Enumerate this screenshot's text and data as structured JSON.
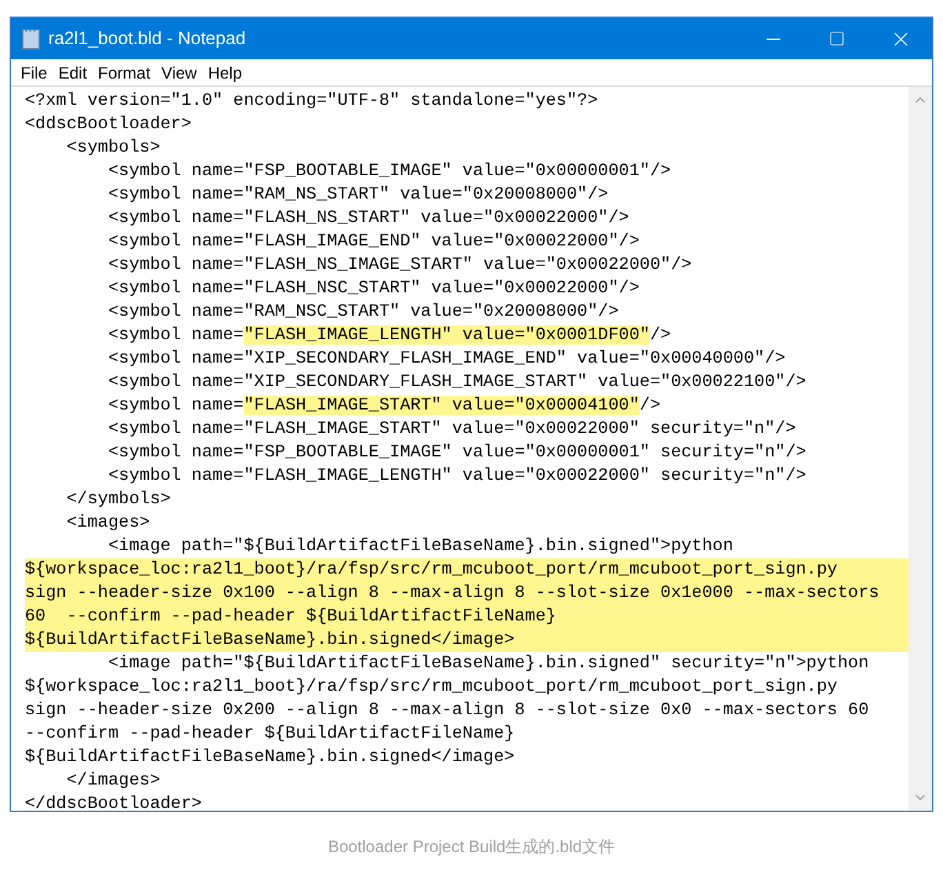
{
  "window": {
    "title": "ra2l1_boot.bld - Notepad"
  },
  "menu": [
    "File",
    "Edit",
    "Format",
    "View",
    "Help"
  ],
  "editor": {
    "lines": [
      {
        "kind": "plain",
        "text": "<?xml version=\"1.0\" encoding=\"UTF-8\" standalone=\"yes\"?>",
        "highlighted": false
      },
      {
        "kind": "plain",
        "text": "<ddscBootloader>",
        "highlighted": false
      },
      {
        "kind": "plain",
        "text": "    <symbols>",
        "highlighted": false
      },
      {
        "kind": "plain",
        "text": "        <symbol name=\"FSP_BOOTABLE_IMAGE\" value=\"0x00000001\"/>",
        "highlighted": false
      },
      {
        "kind": "plain",
        "text": "        <symbol name=\"RAM_NS_START\" value=\"0x20008000\"/>",
        "highlighted": false
      },
      {
        "kind": "plain",
        "text": "        <symbol name=\"FLASH_NS_START\" value=\"0x00022000\"/>",
        "highlighted": false
      },
      {
        "kind": "plain",
        "text": "        <symbol name=\"FLASH_IMAGE_END\" value=\"0x00022000\"/>",
        "highlighted": false
      },
      {
        "kind": "plain",
        "text": "        <symbol name=\"FLASH_NS_IMAGE_START\" value=\"0x00022000\"/>",
        "highlighted": false
      },
      {
        "kind": "plain",
        "text": "        <symbol name=\"FLASH_NSC_START\" value=\"0x00022000\"/>",
        "highlighted": false
      },
      {
        "kind": "plain",
        "text": "        <symbol name=\"RAM_NSC_START\" value=\"0x20008000\"/>",
        "highlighted": false
      },
      {
        "kind": "mixed",
        "segments": [
          {
            "text": "        <symbol name=",
            "highlighted": false
          },
          {
            "text": "\"FLASH_IMAGE_LENGTH\" value=\"0x0001DF00\"",
            "highlighted": true
          },
          {
            "text": "/>",
            "highlighted": false
          }
        ]
      },
      {
        "kind": "plain",
        "text": "        <symbol name=\"XIP_SECONDARY_FLASH_IMAGE_END\" value=\"0x00040000\"/>",
        "highlighted": false
      },
      {
        "kind": "plain",
        "text": "        <symbol name=\"XIP_SECONDARY_FLASH_IMAGE_START\" value=\"0x00022100\"/>",
        "highlighted": false
      },
      {
        "kind": "mixed",
        "segments": [
          {
            "text": "        <symbol name=",
            "highlighted": false
          },
          {
            "text": "\"FLASH_IMAGE_START\" value=\"0x00004100\"",
            "highlighted": true
          },
          {
            "text": "/>",
            "highlighted": false
          }
        ]
      },
      {
        "kind": "plain",
        "text": "        <symbol name=\"FLASH_IMAGE_START\" value=\"0x00022000\" security=\"n\"/>",
        "highlighted": false
      },
      {
        "kind": "plain",
        "text": "        <symbol name=\"FSP_BOOTABLE_IMAGE\" value=\"0x00000001\" security=\"n\"/>",
        "highlighted": false
      },
      {
        "kind": "plain",
        "text": "        <symbol name=\"FLASH_IMAGE_LENGTH\" value=\"0x00022000\" security=\"n\"/>",
        "highlighted": false
      },
      {
        "kind": "plain",
        "text": "    </symbols>",
        "highlighted": false
      },
      {
        "kind": "plain",
        "text": "    <images>",
        "highlighted": false
      },
      {
        "kind": "plain",
        "text": "        <image path=\"${BuildArtifactFileBaseName}.bin.signed\">python",
        "highlighted": false
      },
      {
        "kind": "plain",
        "text": "${workspace_loc:ra2l1_boot}/ra/fsp/src/rm_mcuboot_port/rm_mcuboot_port_sign.py",
        "highlighted": true
      },
      {
        "kind": "plain",
        "text": "sign --header-size 0x100 --align 8 --max-align 8 --slot-size 0x1e000 --max-sectors",
        "highlighted": true
      },
      {
        "kind": "plain",
        "text": "60  --confirm --pad-header ${BuildArtifactFileName}",
        "highlighted": true
      },
      {
        "kind": "plain",
        "text": "${BuildArtifactFileBaseName}.bin.signed</image>",
        "highlighted": true
      },
      {
        "kind": "plain",
        "text": "        <image path=\"${BuildArtifactFileBaseName}.bin.signed\" security=\"n\">python",
        "highlighted": false
      },
      {
        "kind": "plain",
        "text": "${workspace_loc:ra2l1_boot}/ra/fsp/src/rm_mcuboot_port/rm_mcuboot_port_sign.py",
        "highlighted": false
      },
      {
        "kind": "plain",
        "text": "sign --header-size 0x200 --align 8 --max-align 8 --slot-size 0x0 --max-sectors 60",
        "highlighted": false
      },
      {
        "kind": "plain",
        "text": "--confirm --pad-header ${BuildArtifactFileName}",
        "highlighted": false
      },
      {
        "kind": "plain",
        "text": "${BuildArtifactFileBaseName}.bin.signed</image>",
        "highlighted": false
      },
      {
        "kind": "plain",
        "text": "    </images>",
        "highlighted": false
      },
      {
        "kind": "plain",
        "text": "</ddscBootloader>",
        "highlighted": false
      }
    ]
  },
  "caption": "Bootloader Project Build生成的.bld文件"
}
